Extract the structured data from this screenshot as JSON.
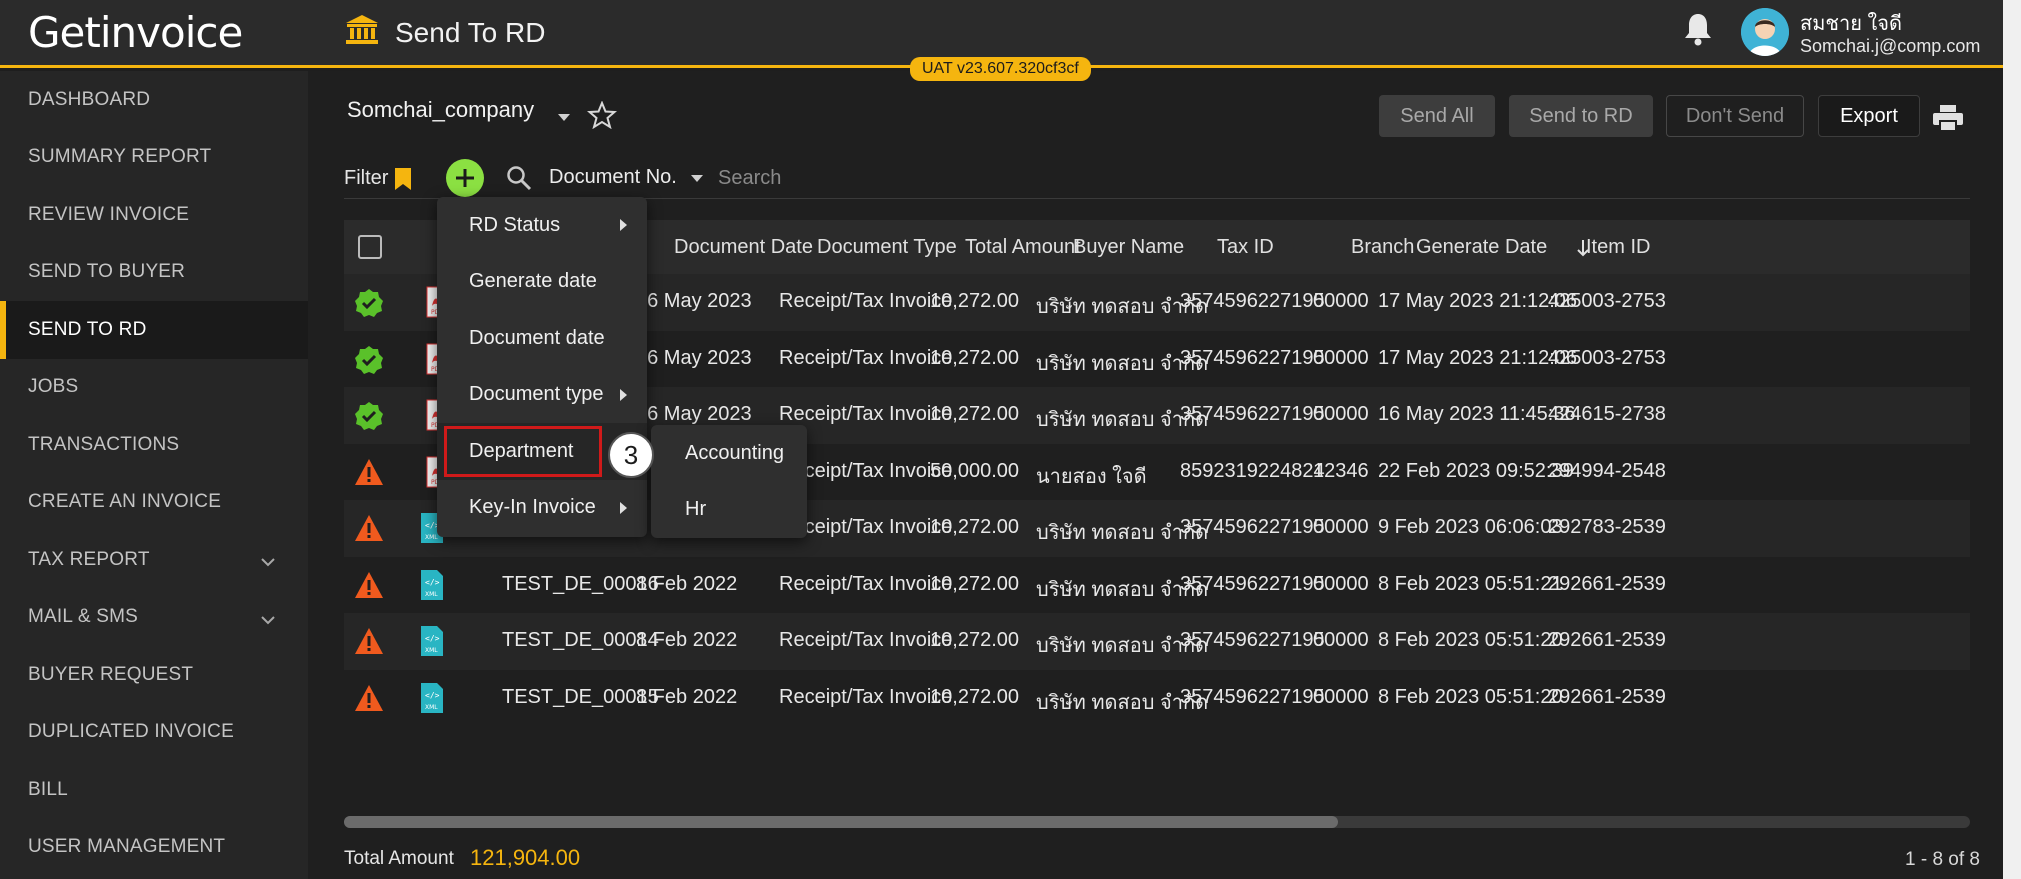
{
  "app": {
    "logo": "Getinvoice",
    "page_title": "Send To RD",
    "version_badge": "UAT v23.607.320cf3cf",
    "user": {
      "name": "สมชาย ใจดี",
      "email": "Somchai.j@comp.com"
    }
  },
  "colors": {
    "accent": "#f5b50f",
    "success": "#5ac12a",
    "warning": "#f05a1e",
    "add": "#8be042",
    "highlight": "#d01a1a"
  },
  "sidebar": {
    "items": [
      {
        "label": "DASHBOARD"
      },
      {
        "label": "SUMMARY REPORT"
      },
      {
        "label": "REVIEW INVOICE"
      },
      {
        "label": "SEND TO BUYER"
      },
      {
        "label": "SEND TO RD",
        "active": true
      },
      {
        "label": "JOBS"
      },
      {
        "label": "TRANSACTIONS"
      },
      {
        "label": "CREATE AN INVOICE"
      },
      {
        "label": "TAX REPORT",
        "expandable": true
      },
      {
        "label": "MAIL & SMS",
        "expandable": true
      },
      {
        "label": "BUYER REQUEST"
      },
      {
        "label": "DUPLICATED INVOICE"
      },
      {
        "label": "BILL"
      },
      {
        "label": "USER MANAGEMENT"
      }
    ]
  },
  "toolbar": {
    "company": "Somchai_company",
    "send_all": "Send All",
    "send_to_rd": "Send to RD",
    "dont_send": "Don't Send",
    "export": "Export"
  },
  "filter": {
    "label": "Filter",
    "field": "Document No.",
    "search_placeholder": "Search"
  },
  "filter_menu": {
    "items": [
      {
        "label": "RD Status",
        "submenu": true
      },
      {
        "label": "Generate date",
        "submenu": false
      },
      {
        "label": "Document date",
        "submenu": false
      },
      {
        "label": "Document type",
        "submenu": true
      },
      {
        "label": "Department",
        "submenu": false,
        "highlighted": true
      },
      {
        "label": "Key-In Invoice",
        "submenu": true
      }
    ],
    "step_number": "3",
    "department_options": [
      "Accounting",
      "Hr"
    ]
  },
  "table": {
    "columns": [
      "Document Date",
      "Document Type",
      "Total Amount",
      "Buyer Name",
      "Tax ID",
      "Branch",
      "Generate Date",
      "Item ID"
    ],
    "rows": [
      {
        "status": "success",
        "file": "pdf",
        "doc_no": "",
        "doc_date": "16 May 2023",
        "doc_type": "Receipt/Tax Invoice",
        "amount": "10,272.00",
        "buyer": "บริษัท ทดสอบ จำกัด",
        "tax_id": "3574596227195",
        "branch": "00000",
        "gen_date": "17 May 2023 21:12:06",
        "item_id": "425003-2753"
      },
      {
        "status": "success",
        "file": "pdf",
        "doc_no": "",
        "doc_date": "16 May 2023",
        "doc_type": "Receipt/Tax Invoice",
        "amount": "10,272.00",
        "buyer": "บริษัท ทดสอบ จำกัด",
        "tax_id": "3574596227195",
        "branch": "00000",
        "gen_date": "17 May 2023 21:12:06",
        "item_id": "425003-2753"
      },
      {
        "status": "success",
        "file": "pdf",
        "doc_no": "",
        "doc_date": "16 May 2023",
        "doc_type": "Receipt/Tax Invoice",
        "amount": "10,272.00",
        "buyer": "บริษัท ทดสอบ จำกัด",
        "tax_id": "3574596227195",
        "branch": "00000",
        "gen_date": "16 May 2023 11:45:36",
        "item_id": "424615-2738"
      },
      {
        "status": "warning",
        "file": "pdf",
        "doc_no": "",
        "doc_date": "",
        "doc_type": "Receipt/Tax Invoice",
        "amount": "50,000.00",
        "buyer": "นายสอง ใจดี",
        "tax_id": "8592319224824",
        "branch": "12346",
        "gen_date": "22 Feb 2023 09:52:39",
        "item_id": "294994-2548"
      },
      {
        "status": "warning",
        "file": "xml",
        "doc_no": "",
        "doc_date": "",
        "doc_type": "Receipt/Tax Invoice",
        "amount": "10,272.00",
        "buyer": "บริษัท ทดสอบ จำกัด",
        "tax_id": "3574596227195",
        "branch": "00000",
        "gen_date": "9 Feb 2023 06:06:03",
        "item_id": "292783-2539"
      },
      {
        "status": "warning",
        "file": "xml",
        "doc_no": "TEST_DE_00016",
        "doc_date": "8 Feb 2022",
        "doc_type": "Receipt/Tax Invoice",
        "amount": "10,272.00",
        "buyer": "บริษัท ทดสอบ จำกัด",
        "tax_id": "3574596227195",
        "branch": "00000",
        "gen_date": "8 Feb 2023 05:51:21",
        "item_id": "292661-2539"
      },
      {
        "status": "warning",
        "file": "xml",
        "doc_no": "TEST_DE_00014",
        "doc_date": "8 Feb 2022",
        "doc_type": "Receipt/Tax Invoice",
        "amount": "10,272.00",
        "buyer": "บริษัท ทดสอบ จำกัด",
        "tax_id": "3574596227195",
        "branch": "00000",
        "gen_date": "8 Feb 2023 05:51:20",
        "item_id": "292661-2539"
      },
      {
        "status": "warning",
        "file": "xml",
        "doc_no": "TEST_DE_00015",
        "doc_date": "8 Feb 2022",
        "doc_type": "Receipt/Tax Invoice",
        "amount": "10,272.00",
        "buyer": "บริษัท ทดสอบ จำกัด",
        "tax_id": "3574596227195",
        "branch": "00000",
        "gen_date": "8 Feb 2023 05:51:20",
        "item_id": "292661-2539"
      }
    ]
  },
  "footer": {
    "total_label": "Total Amount",
    "total_value": "121,904.00",
    "pagination": "1 - 8 of 8"
  }
}
